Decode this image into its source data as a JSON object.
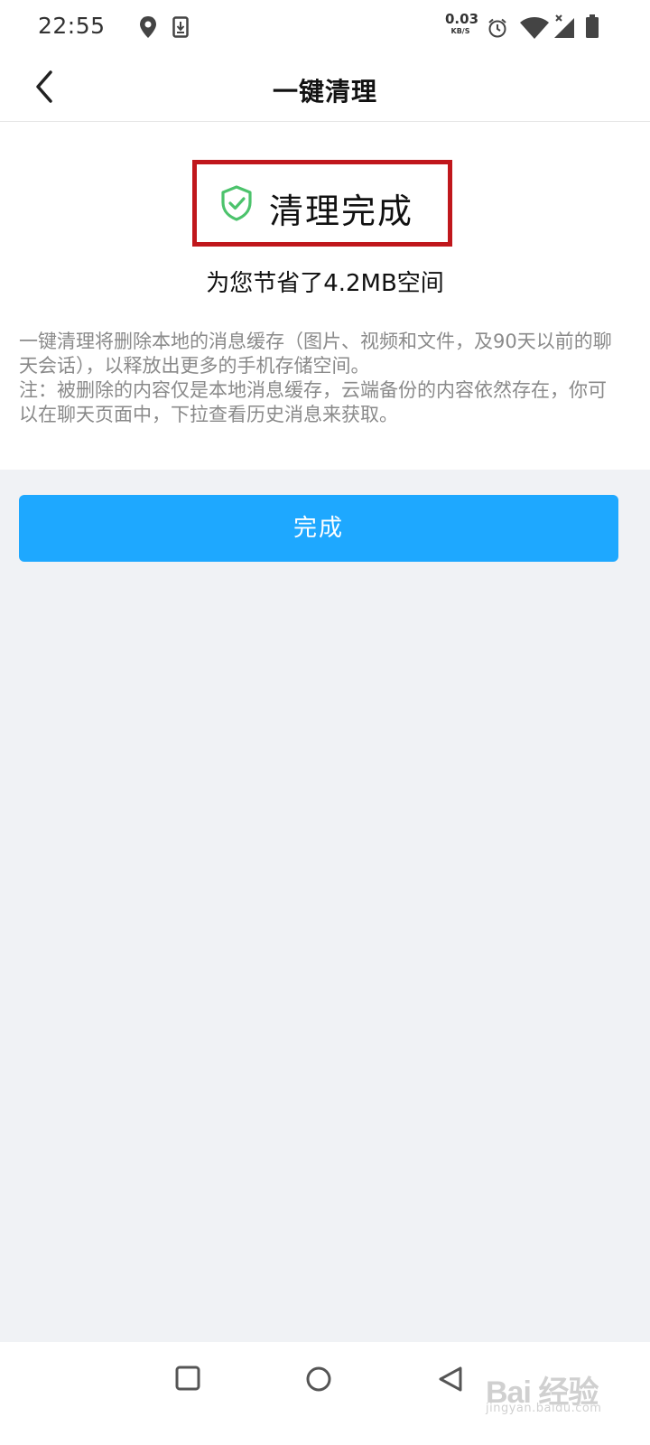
{
  "status_bar": {
    "time": "22:55",
    "net_speed_value": "0.03",
    "net_speed_unit": "KB/S",
    "icons": [
      "location-icon",
      "download-icon",
      "alarm-icon",
      "wifi-icon",
      "signal-icon",
      "battery-icon"
    ]
  },
  "navbar": {
    "back_icon": "chevron-left-icon",
    "title": "一键清理"
  },
  "result": {
    "icon": "shield-check-icon",
    "title": "清理完成",
    "saved_text": "为您节省了4.2MB空间"
  },
  "description": {
    "line1": "一键清理将删除本地的消息缓存（图片、视频和文件，及90天以前的聊天会话），以释放出更多的手机存储空间。",
    "line2": "注：被删除的内容仅是本地消息缓存，云端备份的内容依然存在，你可以在聊天页面中，下拉查看历史消息来获取。"
  },
  "done_button": {
    "label": "完成"
  },
  "system_nav": {
    "icons": [
      "recents-square-icon",
      "home-circle-icon",
      "back-triangle-icon"
    ]
  },
  "watermark": {
    "text": "Bai 经验",
    "subtext": "jingyan.baidu.com"
  },
  "colors": {
    "accent": "#1ea8ff",
    "highlight_border": "#c0171c",
    "shield_green": "#4cc36c",
    "page_bg": "#f0f2f5"
  }
}
